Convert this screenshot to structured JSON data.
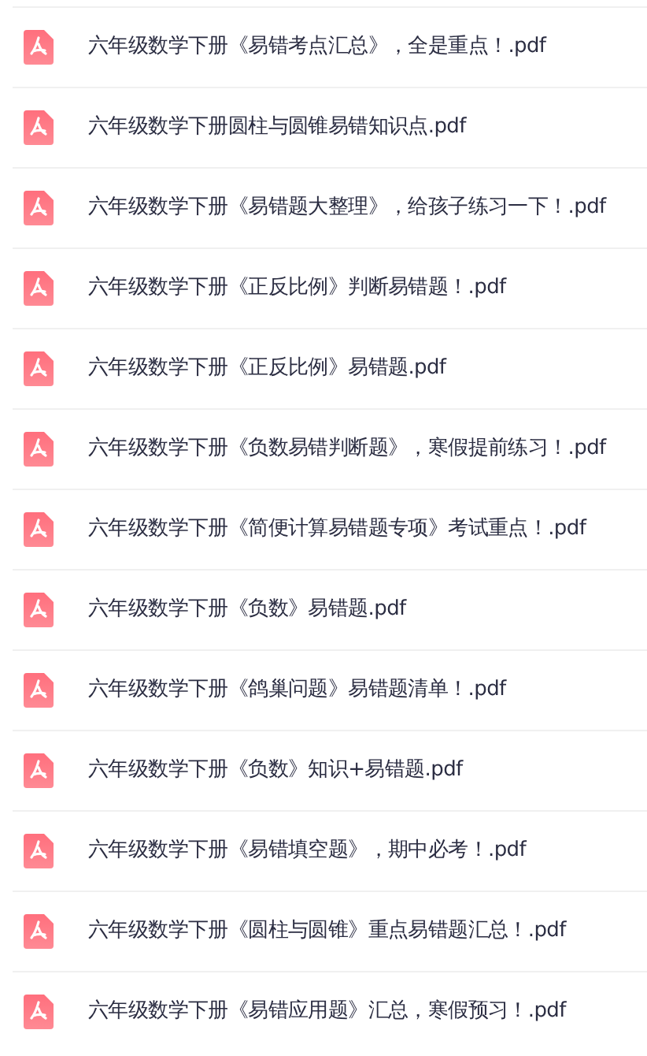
{
  "files": [
    {
      "name": "六年级数学下册《易错考点汇总》，全是重点！.pdf"
    },
    {
      "name": "六年级数学下册圆柱与圆锥易错知识点.pdf"
    },
    {
      "name": "六年级数学下册《易错题大整理》，给孩子练习一下！.pdf"
    },
    {
      "name": "六年级数学下册《正反比例》判断易错题！.pdf"
    },
    {
      "name": "六年级数学下册《正反比例》易错题.pdf"
    },
    {
      "name": "六年级数学下册《负数易错判断题》，寒假提前练习！.pdf"
    },
    {
      "name": "六年级数学下册《简便计算易错题专项》考试重点！.pdf"
    },
    {
      "name": "六年级数学下册《负数》易错题.pdf"
    },
    {
      "name": "六年级数学下册《鸽巢问题》易错题清单！.pdf"
    },
    {
      "name": "六年级数学下册《负数》知识+易错题.pdf"
    },
    {
      "name": "六年级数学下册《易错填空题》，期中必考！.pdf"
    },
    {
      "name": "六年级数学下册《圆柱与圆锥》重点易错题汇总！.pdf"
    },
    {
      "name": "六年级数学下册《易错应用题》汇总，寒假预习！.pdf"
    }
  ]
}
